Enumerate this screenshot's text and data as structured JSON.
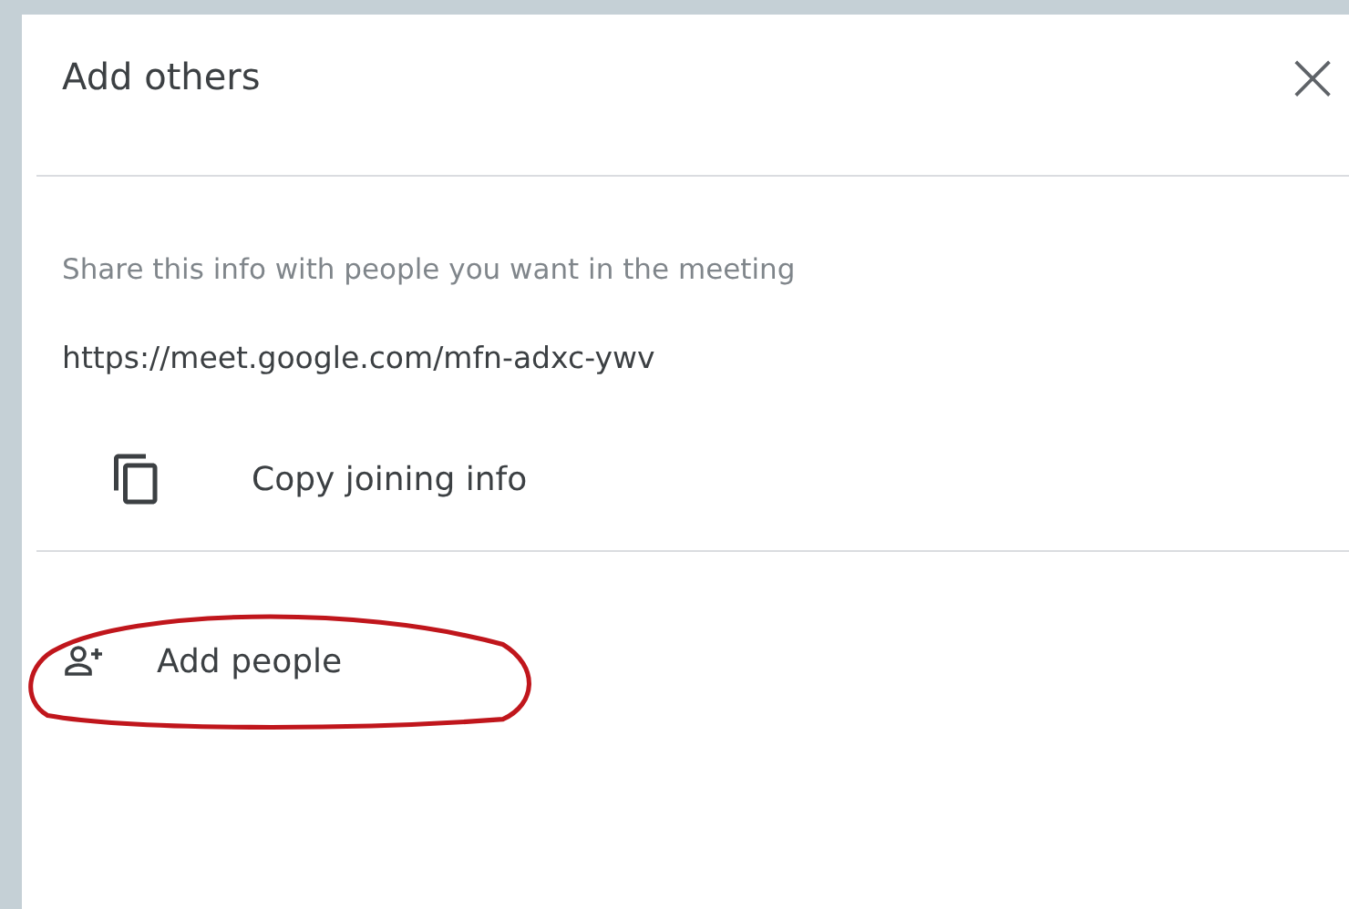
{
  "dialog": {
    "title": "Add others",
    "close_icon": "×"
  },
  "info": {
    "description": "Share this info with people you want in the meeting",
    "link": "https://meet.google.com/mfn-adxc-ywv"
  },
  "copy_button": {
    "label": "Copy joining info"
  },
  "add_people_button": {
    "label": "Add people",
    "circled": true
  }
}
